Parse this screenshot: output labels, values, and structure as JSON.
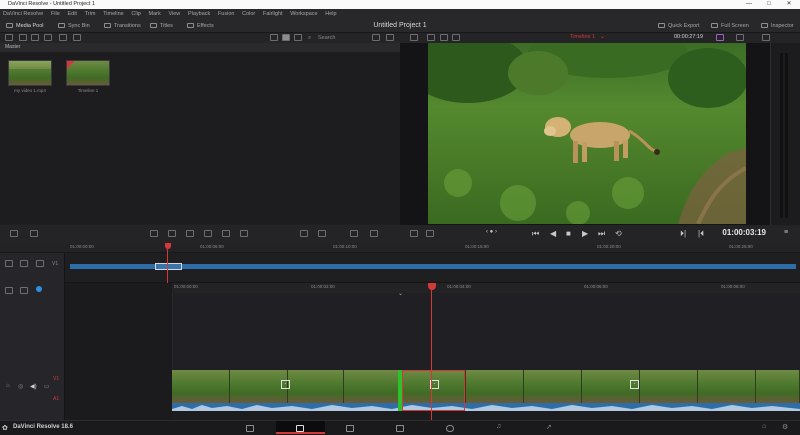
{
  "window": {
    "title": "DaVinci Resolve - Untitled Project 1",
    "minimize": "—",
    "maximize": "□",
    "close": "✕"
  },
  "menu": [
    "DaVinci Resolve",
    "File",
    "Edit",
    "Trim",
    "Timeline",
    "Clip",
    "Mark",
    "View",
    "Playback",
    "Fusion",
    "Color",
    "Fairlight",
    "Workspace",
    "Help"
  ],
  "toolbar": {
    "media_pool": "Media Pool",
    "sync_bin": "Sync Bin",
    "transitions": "Transitions",
    "titles": "Titles",
    "effects": "Effects",
    "project_title": "Untitled Project 1",
    "quick_export": "Quick Export",
    "full_screen": "Full Screen",
    "inspector": "Inspector"
  },
  "media_pool": {
    "search_label": "Search",
    "bin": "Master",
    "items": [
      {
        "label": "my video 1.mp4"
      },
      {
        "label": "Timeline 1"
      }
    ]
  },
  "viewer": {
    "timeline_name": "Timeline 1",
    "timecode_top": "00:00:27:19",
    "timecode": "01:00:03:19"
  },
  "timeline": {
    "ruler_top": [
      "01:00:00:00",
      "01:00:06:00",
      "01:00:10:00",
      "01:00:15:00",
      "01:00:20:00",
      "01:00:25:00"
    ],
    "ruler_main": [
      "01:00:00:00",
      "01:00:02:00",
      "01:00:04:00",
      "01:00:06:00",
      "01:00:08:00"
    ],
    "track_labels": {
      "video": "V1",
      "audio": "A1"
    }
  },
  "bottom": {
    "brand": "DaVinci Resolve 18.6"
  },
  "colors": {
    "accent_red": "#d23a3a",
    "clip_blue": "#2e6ea8",
    "edit_green": "#2ec12e"
  }
}
